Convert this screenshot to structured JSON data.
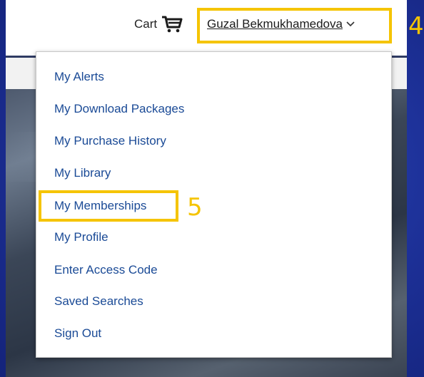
{
  "header": {
    "cart_label": "Cart",
    "user_name": "Guzal Bekmukhamedova"
  },
  "account_menu": {
    "items": [
      {
        "label": "My Alerts"
      },
      {
        "label": "My Download Packages"
      },
      {
        "label": "My Purchase History"
      },
      {
        "label": "My Library"
      },
      {
        "label": "My Memberships"
      },
      {
        "label": "My Profile"
      },
      {
        "label": "Enter Access Code"
      },
      {
        "label": "Saved Searches"
      },
      {
        "label": "Sign Out"
      }
    ]
  },
  "callouts": {
    "user_menu_step": "4",
    "memberships_step": "5"
  },
  "icons": {
    "cart": "shopping-cart-icon",
    "user_menu_toggle": "chevron-down-icon"
  },
  "colors": {
    "highlight": "#f5c400",
    "menu_link": "#1a4a96",
    "slide_background": "#1c2f95"
  }
}
